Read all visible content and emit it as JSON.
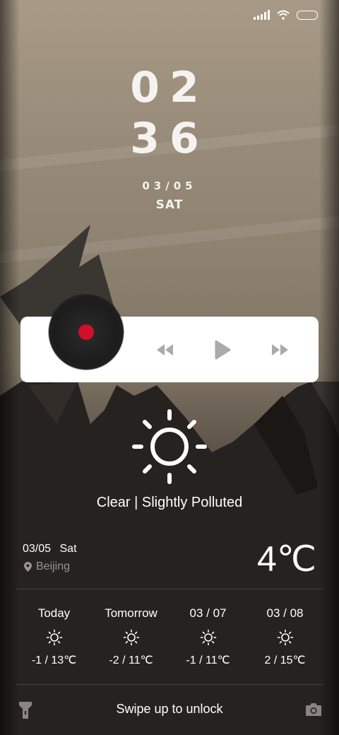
{
  "clock": {
    "hour": "02",
    "minute": "36",
    "date": "03/05",
    "weekday": "SAT"
  },
  "music": {
    "icons": {
      "prev": "rewind-icon",
      "play": "play-icon",
      "next": "fast-forward-icon",
      "disc": "vinyl-disc-icon"
    },
    "accent": "#d0102b"
  },
  "weather": {
    "icon": "sun-icon",
    "condition": "Clear | Slightly Polluted",
    "date": "03/05",
    "weekday": "Sat",
    "location": "Beijing",
    "temperature": "4℃"
  },
  "forecast": [
    {
      "day": "Today",
      "icon": "sun-icon",
      "range": "-1 / 13℃"
    },
    {
      "day": "Tomorrow",
      "icon": "sun-icon",
      "range": "-2 / 11℃"
    },
    {
      "day": "03 / 07",
      "icon": "sun-icon",
      "range": "-1 / 11℃"
    },
    {
      "day": "03 / 08",
      "icon": "sun-icon",
      "range": "2 / 15℃"
    }
  ],
  "bottom": {
    "unlock_text": "Swipe up to unlock",
    "left_icon": "flashlight-icon",
    "right_icon": "camera-icon"
  },
  "status": {
    "icons": [
      "signal-icon",
      "wifi-icon",
      "battery-icon"
    ]
  }
}
